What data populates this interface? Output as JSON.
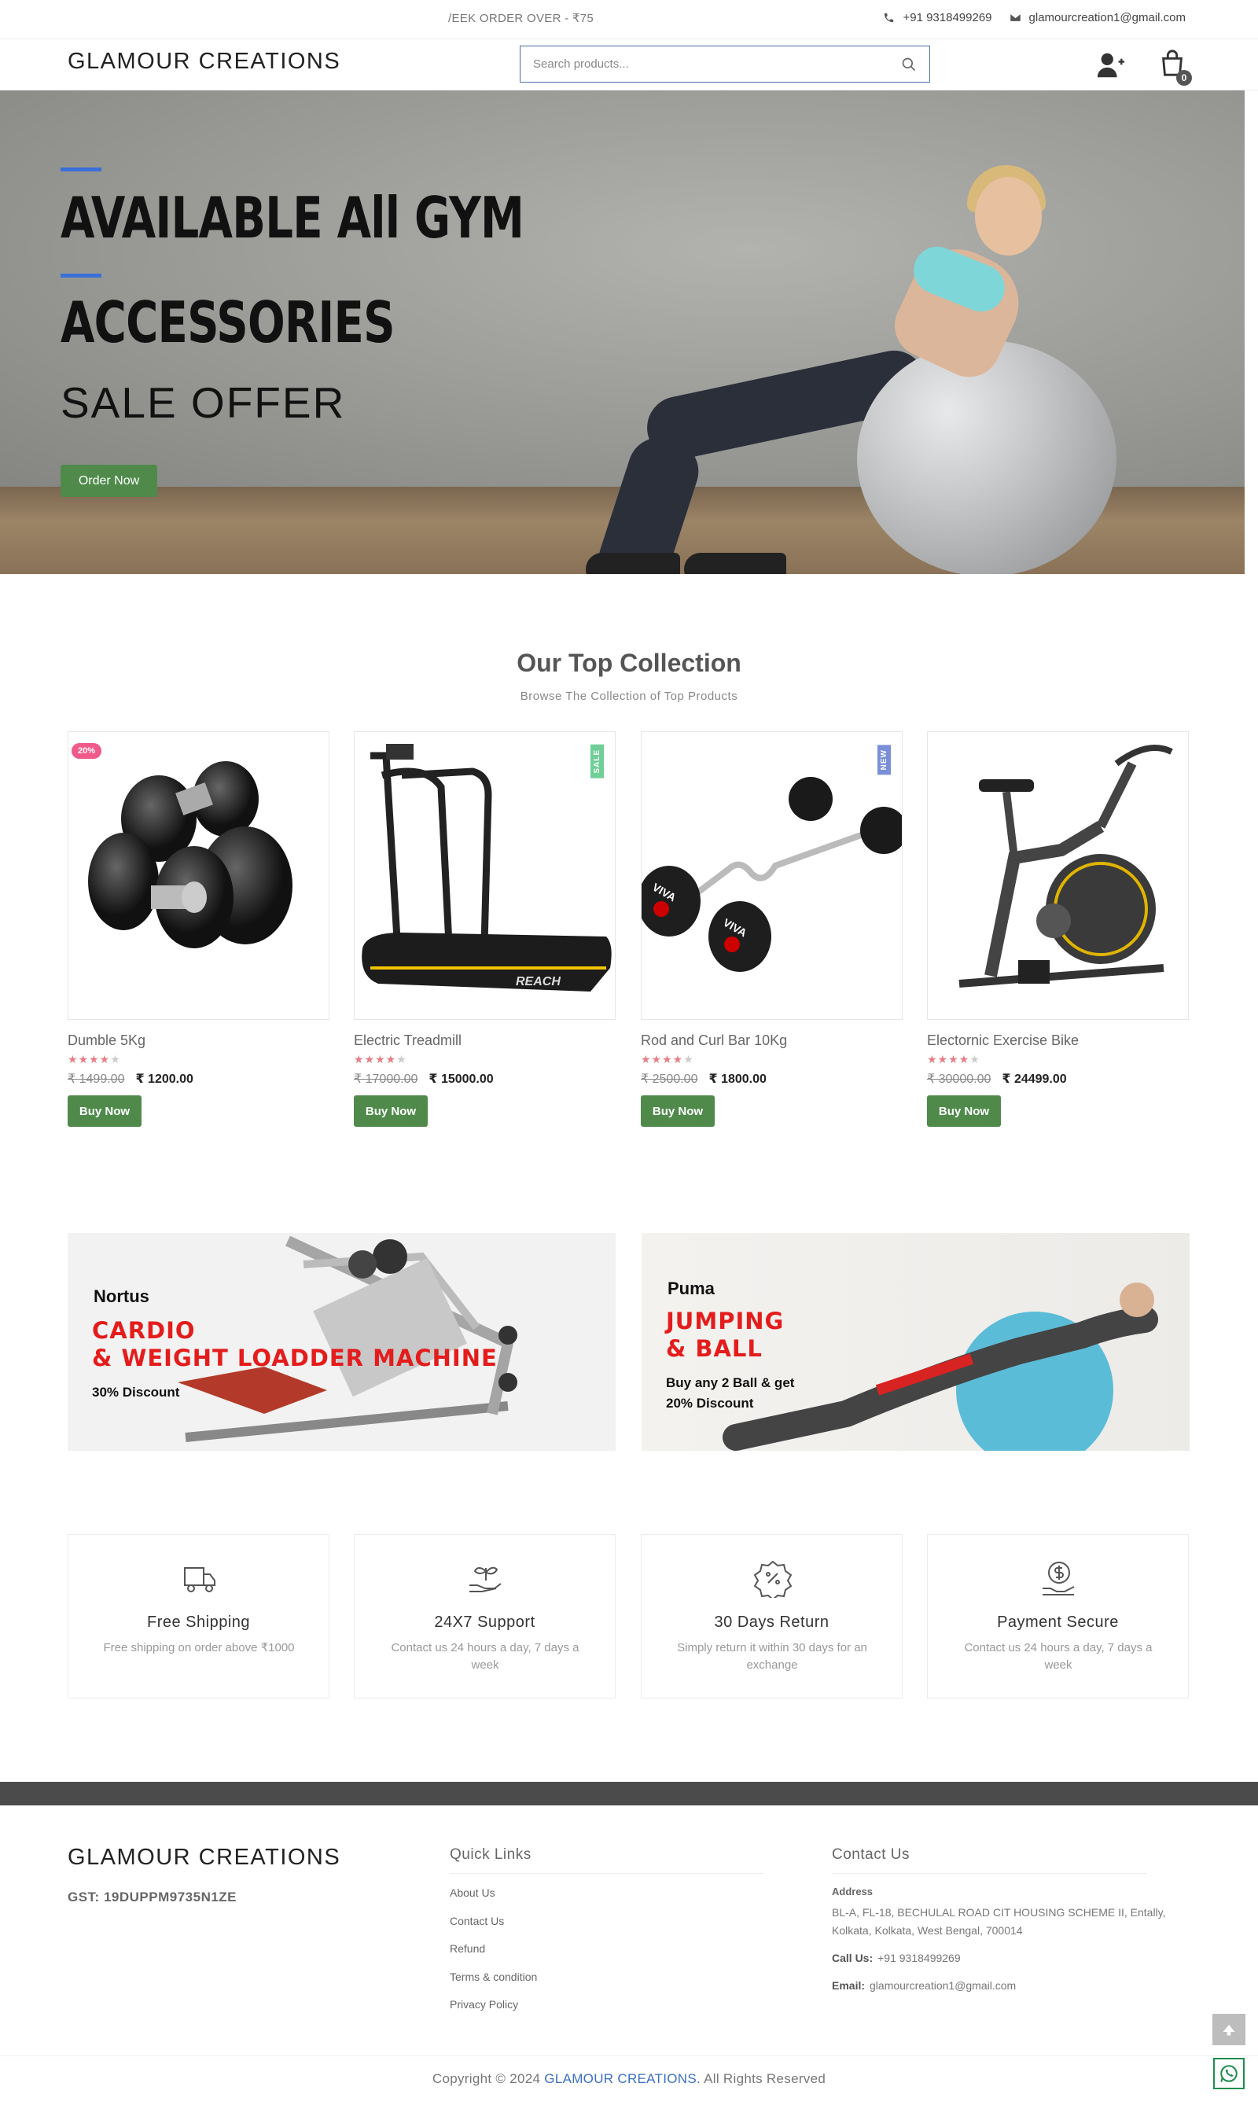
{
  "topbar": {
    "ticker": "/EEK ORDER OVER - ₹75",
    "phone": "+91 9318499269",
    "email": "glamourcreation1@gmail.com"
  },
  "header": {
    "brand": "GLAMOUR CREATIONS",
    "search_placeholder": "Search products...",
    "cart_count": "0"
  },
  "hero": {
    "line1": "AVAILABLE All GYM",
    "line2": "ACCESSORIES",
    "line3": "SALE OFFER",
    "button": "Order Now"
  },
  "collection": {
    "title": "Our Top Collection",
    "subtitle": "Browse The Collection of Top Products",
    "products": [
      {
        "name": "Dumble 5Kg",
        "rating": 4,
        "old_price": "₹ 1499.00",
        "price": "₹ 1200.00",
        "badge": "20%",
        "button": "Buy Now"
      },
      {
        "name": "Electric Treadmill",
        "rating": 4,
        "old_price": "₹ 17000.00",
        "price": "₹ 15000.00",
        "badge": "SALE",
        "button": "Buy Now"
      },
      {
        "name": "Rod and Curl Bar 10Kg",
        "rating": 4,
        "old_price": "₹ 2500.00",
        "price": "₹ 1800.00",
        "badge": "NEW",
        "button": "Buy Now"
      },
      {
        "name": "Electornic Exercise Bike",
        "rating": 4,
        "old_price": "₹ 30000.00",
        "price": "₹ 24499.00",
        "badge": "",
        "button": "Buy Now"
      }
    ],
    "colors": {
      "sale_badge": "#6fcf97",
      "new_badge": "#7a8fd8",
      "pct_badge": "#f05a8a",
      "button": "#4f8a4b"
    }
  },
  "banners": [
    {
      "brand": "Nortus",
      "title_line1": "CARDIO",
      "title_line2": "& WEIGHT LOADDER MACHINE",
      "promo": "30% Discount"
    },
    {
      "brand": "Puma",
      "title_line1": "JUMPING",
      "title_line2": "& BALL",
      "promo_line1": "Buy any 2 Ball & get",
      "promo_line2": "20% Discount"
    }
  ],
  "features": [
    {
      "icon": "truck-icon",
      "title": "Free Shipping",
      "desc": "Free shipping on order above ₹1000"
    },
    {
      "icon": "plant-hand-icon",
      "title": "24X7 Support",
      "desc": "Contact us 24 hours a day, 7 days a week"
    },
    {
      "icon": "percent-badge-icon",
      "title": "30 Days Return",
      "desc": "Simply return it within 30 days for an exchange"
    },
    {
      "icon": "dollar-hand-icon",
      "title": "Payment Secure",
      "desc": "Contact us 24 hours a day, 7 days a week"
    }
  ],
  "footer": {
    "brand": "GLAMOUR CREATIONS",
    "gst": "GST: 19DUPPM9735N1ZE",
    "quick_links_title": "Quick Links",
    "links": [
      "About Us",
      "Contact Us",
      "Refund",
      "Terms & condition",
      "Privacy Policy"
    ],
    "contact_title": "Contact Us",
    "address_label": "Address",
    "address": "BL-A, FL-18, BECHULAL ROAD CIT HOUSING SCHEME II, Entally, Kolkata, Kolkata, West Bengal, 700014",
    "call_label": "Call Us:",
    "call": "+91 9318499269",
    "email_label": "Email:",
    "email": "glamourcreation1@gmail.com",
    "copyright_pre": "Copyright © 2024",
    "copyright_brand": "GLAMOUR CREATIONS.",
    "copyright_post": "All Rights Reserved"
  }
}
